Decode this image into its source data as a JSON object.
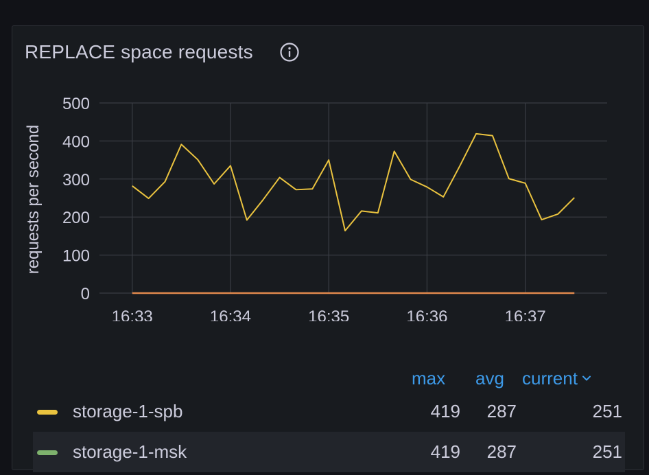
{
  "panel": {
    "title": "REPLACE space requests",
    "info_icon": "info-circle-icon"
  },
  "colors": {
    "background": "#111217",
    "panel": "#181b1f",
    "grid": "#3a3d44",
    "axis_text": "#ccccdc",
    "legend_header": "#3d9ae8",
    "series_spb": "#eac33f",
    "series_msk": "#7eb26d",
    "zero_line": "#e0894d"
  },
  "chart_data": {
    "type": "line",
    "title": "REPLACE space requests",
    "xlabel": "",
    "ylabel": "requests per second",
    "ylim": [
      0,
      500
    ],
    "yticks": [
      "0",
      "100",
      "200",
      "300",
      "400",
      "500"
    ],
    "xticks": [
      "16:33",
      "16:34",
      "16:35",
      "16:36",
      "16:37"
    ],
    "xlim": [
      "16:32:40",
      "16:37:50"
    ],
    "grid": true,
    "legend_placement": "bottom",
    "series": [
      {
        "name": "storage-1-spb",
        "color": "#eac33f",
        "x": [
          "16:33:00",
          "16:33:10",
          "16:33:20",
          "16:33:30",
          "16:33:40",
          "16:33:50",
          "16:34:00",
          "16:34:10",
          "16:34:20",
          "16:34:30",
          "16:34:40",
          "16:34:50",
          "16:35:00",
          "16:35:10",
          "16:35:20",
          "16:35:30",
          "16:35:40",
          "16:35:50",
          "16:36:00",
          "16:36:10",
          "16:36:20",
          "16:36:30",
          "16:36:40",
          "16:36:50",
          "16:37:00",
          "16:37:10",
          "16:37:20",
          "16:37:30"
        ],
        "values": [
          282,
          249,
          293,
          391,
          351,
          287,
          335,
          192,
          246,
          304,
          272,
          274,
          350,
          164,
          216,
          211,
          373,
          299,
          279,
          253,
          334,
          419,
          414,
          301,
          289,
          193,
          208,
          251
        ]
      },
      {
        "name": "storage-1-msk",
        "color": "#7eb26d",
        "x": [
          "16:33:00",
          "16:37:30"
        ],
        "values": [
          0,
          0
        ]
      }
    ]
  },
  "legend": {
    "headers": {
      "max": "max",
      "avg": "avg",
      "current": "current"
    },
    "sort_icon": "chevron-down-icon",
    "rows": [
      {
        "name": "storage-1-spb",
        "color": "#eac33f",
        "max": "419",
        "avg": "287",
        "current": "251"
      },
      {
        "name": "storage-1-msk",
        "color": "#7eb26d",
        "max": "419",
        "avg": "287",
        "current": "251"
      }
    ]
  }
}
